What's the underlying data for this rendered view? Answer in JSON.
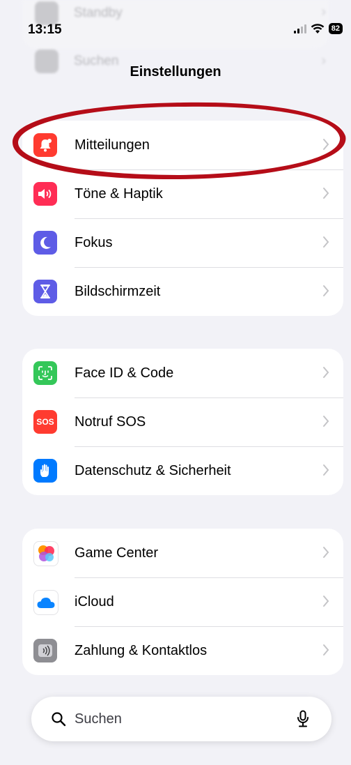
{
  "status_bar": {
    "time": "13:15",
    "battery": "82"
  },
  "background_ghost": {
    "row1": "Standby",
    "row2": "Suchen"
  },
  "nav": {
    "title": "Einstellungen"
  },
  "groups": [
    {
      "items": [
        {
          "label": "Mitteilungen",
          "icon": "bell-icon",
          "color": "#ff3b30"
        },
        {
          "label": "Töne & Haptik",
          "icon": "speaker-icon",
          "color": "#ff2d55"
        },
        {
          "label": "Fokus",
          "icon": "moon-icon",
          "color": "#5e5ce6"
        },
        {
          "label": "Bildschirmzeit",
          "icon": "hourglass-icon",
          "color": "#5e5ce6"
        }
      ]
    },
    {
      "items": [
        {
          "label": "Face ID & Code",
          "icon": "face-id-icon",
          "color": "#34c759"
        },
        {
          "label": "Notruf SOS",
          "icon": "sos-icon",
          "color": "#ff3b30",
          "glyph": "SOS"
        },
        {
          "label": "Datenschutz & Sicherheit",
          "icon": "hand-icon",
          "color": "#007aff"
        }
      ]
    },
    {
      "items": [
        {
          "label": "Game Center",
          "icon": "game-center-icon",
          "color": "#ff2d55"
        },
        {
          "label": "iCloud",
          "icon": "cloud-icon",
          "color": "#0a84ff"
        },
        {
          "label": "Zahlung & Kontaktlos",
          "icon": "contactless-icon",
          "color": "#8e8e93"
        }
      ]
    }
  ],
  "search": {
    "placeholder": "Suchen"
  },
  "highlight_color": "#b50d18"
}
